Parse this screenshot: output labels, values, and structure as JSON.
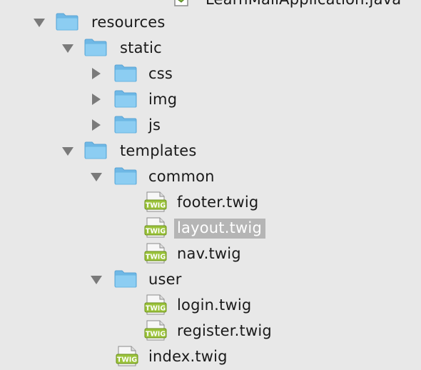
{
  "tree": {
    "partial_top_item": "LearnMallApplication.java",
    "items": [
      {
        "name": "resources",
        "type": "folder",
        "expanded": true
      },
      {
        "name": "static",
        "type": "folder",
        "expanded": true
      },
      {
        "name": "css",
        "type": "folder",
        "expanded": false
      },
      {
        "name": "img",
        "type": "folder",
        "expanded": false
      },
      {
        "name": "js",
        "type": "folder",
        "expanded": false
      },
      {
        "name": "templates",
        "type": "folder",
        "expanded": true
      },
      {
        "name": "common",
        "type": "folder",
        "expanded": true
      },
      {
        "name": "footer.twig",
        "type": "file",
        "icon": "twig-file-icon"
      },
      {
        "name": "layout.twig",
        "type": "file",
        "icon": "twig-file-icon",
        "selected": true
      },
      {
        "name": "nav.twig",
        "type": "file",
        "icon": "twig-file-icon"
      },
      {
        "name": "user",
        "type": "folder",
        "expanded": true
      },
      {
        "name": "login.twig",
        "type": "file",
        "icon": "twig-file-icon"
      },
      {
        "name": "register.twig",
        "type": "file",
        "icon": "twig-file-icon"
      },
      {
        "name": "index.twig",
        "type": "file",
        "icon": "twig-file-icon"
      }
    ]
  },
  "colors": {
    "background": "#e8e8e8",
    "folder_blue": "#8ccdf2",
    "twig_green": "#9bc33b",
    "selection": "#b5b5b5",
    "arrow": "#7a7a7a"
  }
}
